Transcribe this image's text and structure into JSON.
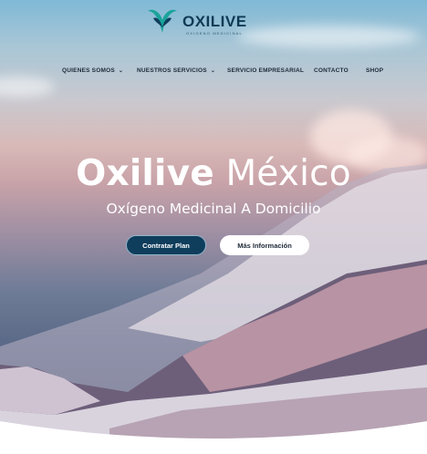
{
  "brand": {
    "name": "OXILIVE",
    "tagline": "OXIGENO MEDICINAL"
  },
  "nav": {
    "items": [
      {
        "label": "QUIENES SOMOS",
        "has_dropdown": true
      },
      {
        "label": "NUESTROS SERVICIOS",
        "has_dropdown": true
      },
      {
        "label": "SERVICIO EMPRESARIAL",
        "has_dropdown": false
      },
      {
        "label": "CONTACTO",
        "has_dropdown": false
      },
      {
        "label": "SHOP",
        "has_dropdown": false
      }
    ],
    "chevron": "⌄"
  },
  "hero": {
    "title_bold": "Oxilive",
    "title_light": "México",
    "subtitle": "Oxígeno Medicinal A Domicilio",
    "primary_button": "Contratar Plan",
    "secondary_button": "Más Información"
  },
  "colors": {
    "brand_dark": "#0f3d5c",
    "brand_teal": "#1aa39a",
    "nav_text": "#1d2a38"
  },
  "icons": {
    "logo": "wing-heart-logo-icon",
    "dropdown": "chevron-down-icon"
  }
}
